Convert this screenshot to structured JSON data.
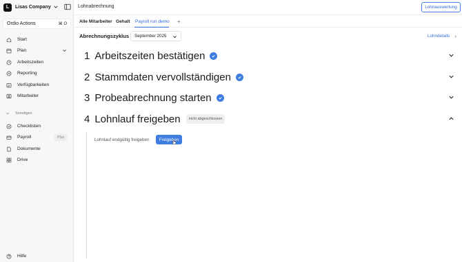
{
  "sidebar": {
    "company_initial": "L",
    "company_name": "Lisas Company",
    "actions_label": "Ordio Actions",
    "actions_shortcut": "⌘ O",
    "items": [
      {
        "label": "Start",
        "icon": "home-icon"
      },
      {
        "label": "Plan",
        "icon": "calendar-icon"
      },
      {
        "label": "Arbeitszeiten",
        "icon": "clock-icon"
      },
      {
        "label": "Reporting",
        "icon": "chart-icon"
      },
      {
        "label": "Verfügbarkeiten",
        "icon": "availability-icon"
      },
      {
        "label": "Mitarbeiter",
        "icon": "users-icon"
      }
    ],
    "section_label": "Sonstiges",
    "section_items": [
      {
        "label": "Checklisten",
        "icon": "checklist-icon"
      },
      {
        "label": "Payroll",
        "icon": "payroll-icon",
        "badge": "Plus"
      },
      {
        "label": "Dokumente",
        "icon": "document-icon"
      },
      {
        "label": "Drive",
        "icon": "drive-icon"
      }
    ],
    "help_label": "Hilfe"
  },
  "header": {
    "title": "Lohnabrechnung",
    "report_button": "Lohnauswertung"
  },
  "tabs": [
    {
      "label": "Alle Mitarbeiter"
    },
    {
      "label": "Gehalt"
    },
    {
      "label": "Payroll run demo",
      "active": true
    }
  ],
  "tab_add": "+",
  "cycle": {
    "label": "Abrechnungszyklus",
    "selected": "September 2025",
    "details_link": "Lohndetails"
  },
  "steps": [
    {
      "number": "1",
      "title": "Arbeitszeiten bestätigen",
      "done": true
    },
    {
      "number": "2",
      "title": "Stammdaten vervollständigen",
      "done": true
    },
    {
      "number": "3",
      "title": "Probeabrechnung starten",
      "done": true
    },
    {
      "number": "4",
      "title": "Lohnlauf freigeben",
      "done": false,
      "status": "nicht abgeschlossen"
    }
  ],
  "release": {
    "text": "Lohnlauf endgültig freigeben",
    "button": "Freigeben"
  },
  "colors": {
    "accent": "#3f7de0",
    "link": "#2f6ad8"
  }
}
